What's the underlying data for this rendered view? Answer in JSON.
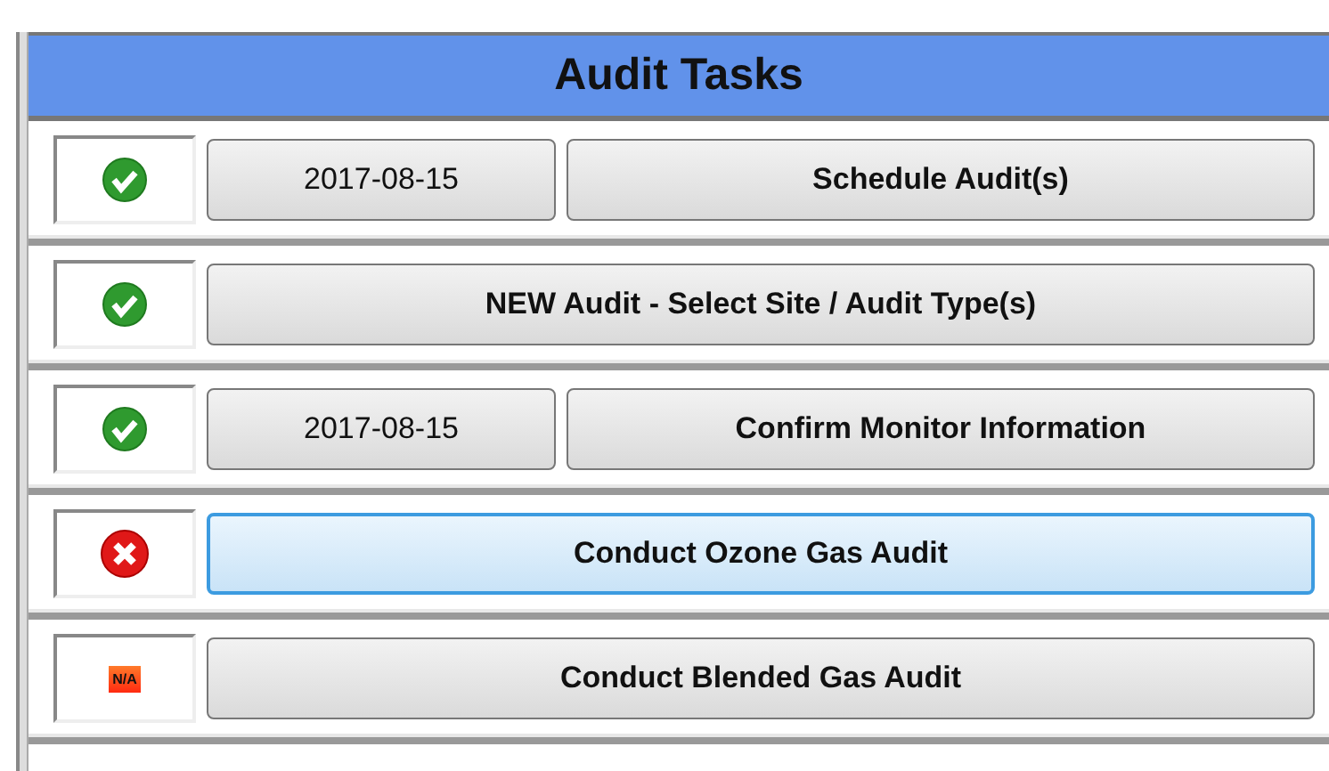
{
  "title": "Audit Tasks",
  "tasks": [
    {
      "kind": "done",
      "date": "2017-08-15",
      "label": "Schedule Audit(s)",
      "focused": false
    },
    {
      "kind": "done",
      "label": "NEW Audit - Select Site / Audit Type(s)",
      "focused": false
    },
    {
      "kind": "done",
      "date": "2017-08-15",
      "label": "Confirm Monitor Information",
      "focused": false
    },
    {
      "kind": "failed",
      "label": "Conduct Ozone Gas Audit",
      "focused": true
    },
    {
      "kind": "na",
      "badge": "N/A",
      "label": "Conduct Blended Gas Audit",
      "focused": false
    }
  ]
}
